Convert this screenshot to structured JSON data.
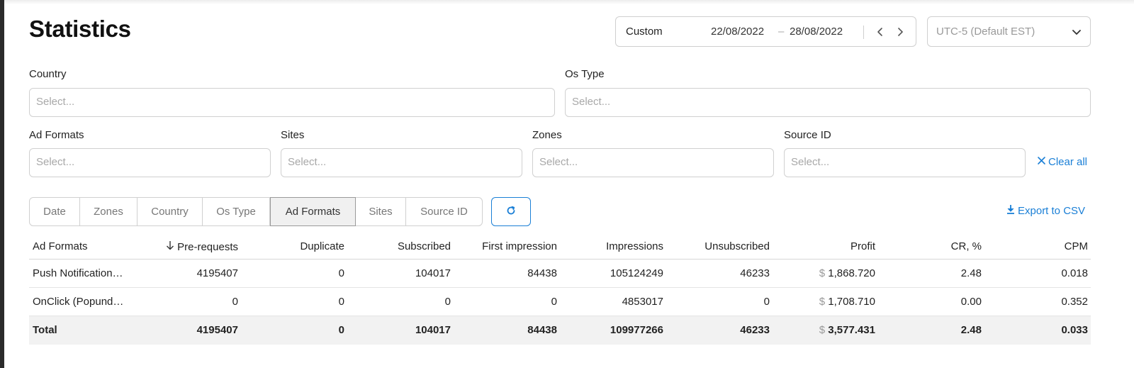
{
  "page": {
    "title": "Statistics"
  },
  "date_range": {
    "preset": "Custom",
    "from": "22/08/2022",
    "separator": "–",
    "to": "28/08/2022"
  },
  "timezone": {
    "value": "UTC-5 (Default EST)"
  },
  "filters": {
    "country": {
      "label": "Country",
      "placeholder": "Select..."
    },
    "os_type": {
      "label": "Os Type",
      "placeholder": "Select..."
    },
    "ad_formats": {
      "label": "Ad Formats",
      "placeholder": "Select..."
    },
    "sites": {
      "label": "Sites",
      "placeholder": "Select..."
    },
    "zones": {
      "label": "Zones",
      "placeholder": "Select..."
    },
    "source_id": {
      "label": "Source ID",
      "placeholder": "Select..."
    },
    "clear_all": "Clear all"
  },
  "group_tabs": [
    "Date",
    "Zones",
    "Country",
    "Os Type",
    "Ad Formats",
    "Sites",
    "Source ID"
  ],
  "active_tab": "Ad Formats",
  "export_label": "Export to CSV",
  "table": {
    "columns": [
      "Ad Formats",
      "Pre-requests",
      "Duplicate",
      "Subscribed",
      "First impression",
      "Impressions",
      "Unsubscribed",
      "Profit",
      "CR, %",
      "CPM"
    ],
    "sorted_column": "Pre-requests",
    "currency_symbol": "$",
    "rows": [
      [
        "Push Notification…",
        "4195407",
        "0",
        "104017",
        "84438",
        "105124249",
        "46233",
        "1,868.720",
        "2.48",
        "0.018"
      ],
      [
        "OnClick (Popund…",
        "0",
        "0",
        "0",
        "0",
        "4853017",
        "0",
        "1,708.710",
        "0.00",
        "0.352"
      ]
    ],
    "total": [
      "Total",
      "4195407",
      "0",
      "104017",
      "84438",
      "109977266",
      "46233",
      "3,577.431",
      "2.48",
      "0.033"
    ]
  },
  "colors": {
    "accent": "#1a7fd6",
    "placeholder": "#a8a8a8",
    "border": "#d0d0d0",
    "total_row_bg": "#f2f2f2"
  }
}
